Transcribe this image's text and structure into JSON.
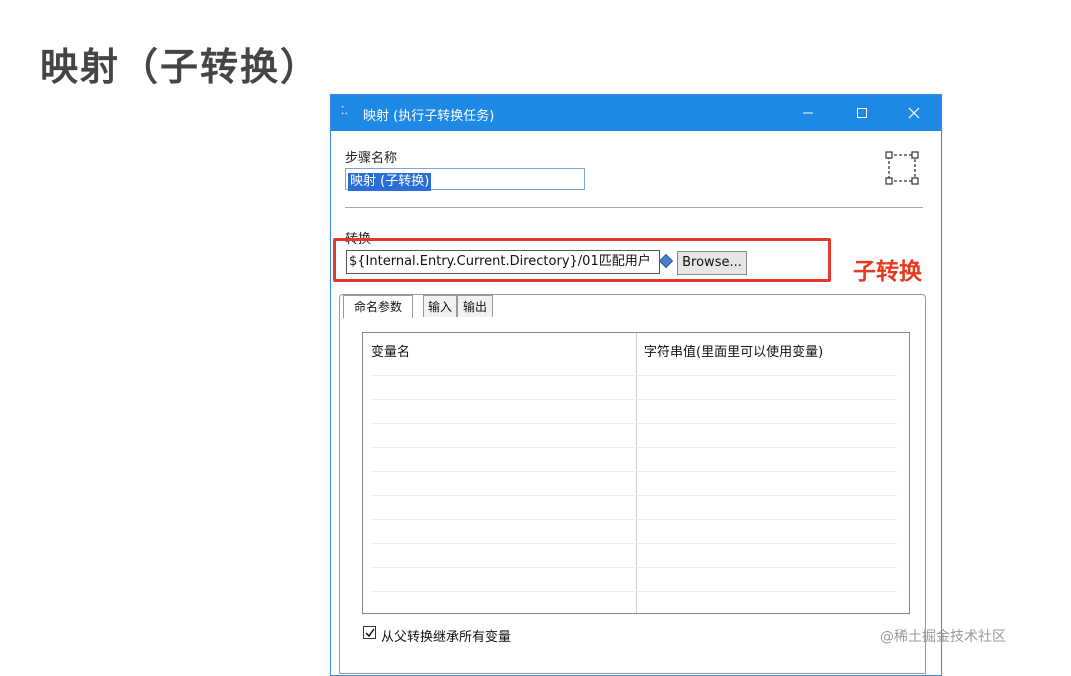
{
  "slide": {
    "title": "映射（子转换）"
  },
  "dialog": {
    "title": "映射 (执行子转换任务)",
    "step_name_label": "步骤名称",
    "step_name_value": "映射 (子转换)",
    "transformation_label": "转换",
    "transformation_path": "${Internal.Entry.Current.Directory}/01匹配用户",
    "browse_label": "Browse...",
    "tabs": [
      {
        "label": "命名参数",
        "active": true
      },
      {
        "label": "输入",
        "active": false
      },
      {
        "label": "输出",
        "active": false
      }
    ],
    "table": {
      "columns": [
        "变量名",
        "字符串值(里面里可以使用变量)"
      ]
    },
    "inherit_checkbox": {
      "label": "从父转换继承所有变量",
      "checked": true
    }
  },
  "annotation": {
    "text": "子转换",
    "color": "#e8391e"
  },
  "watermark": "@稀土掘金技术社区",
  "colors": {
    "titlebar": "#1e88e5",
    "highlight": "#e23a2a"
  }
}
